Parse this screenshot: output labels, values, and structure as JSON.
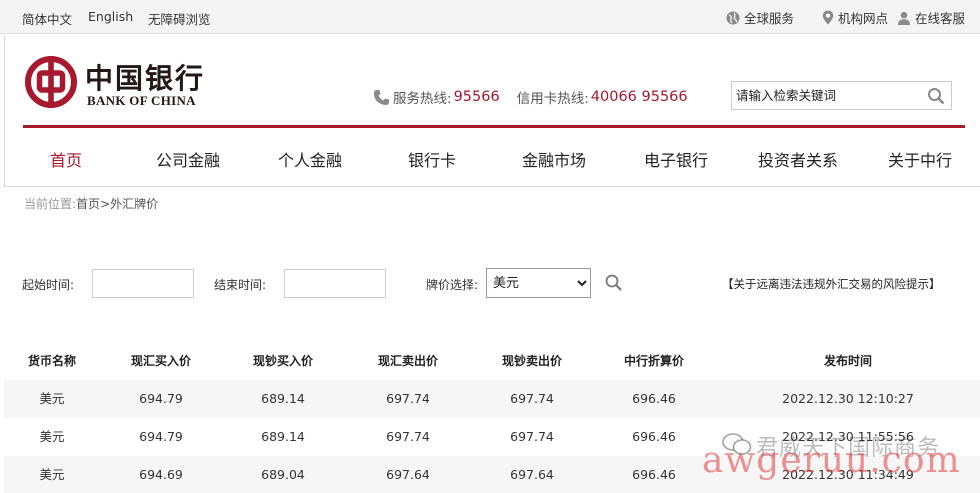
{
  "topbar": {
    "langs": [
      "简体中文",
      "English",
      "无障碍浏览"
    ],
    "right": [
      {
        "icon": "globe-icon",
        "label": "全球服务"
      },
      {
        "icon": "location-pin-icon",
        "label": "机构网点"
      },
      {
        "icon": "user-icon",
        "label": "在线客服"
      }
    ]
  },
  "header": {
    "logo_cn": "中国银行",
    "logo_en": "BANK OF CHINA",
    "service_label": "服务热线:",
    "service_number": "95566",
    "card_label": "信用卡热线:",
    "card_number": "40066 95566",
    "search_placeholder": "请输入检索关键词",
    "brand_color": "#a6192e"
  },
  "nav": [
    "首页",
    "公司金融",
    "个人金融",
    "银行卡",
    "金融市场",
    "电子银行",
    "投资者关系",
    "关于中行"
  ],
  "breadcrumb": {
    "prefix": "当前位置:",
    "home": "首页",
    "sep": ">",
    "current": "外汇牌价"
  },
  "filters": {
    "start_label": "起始时间:",
    "end_label": "结束时间:",
    "currency_label": "牌价选择:",
    "currency_selected": "美元",
    "risk_notice": "【关于远离违法违规外汇交易的风险提示】"
  },
  "table": {
    "headers": [
      "货币名称",
      "现汇买入价",
      "现钞买入价",
      "现汇卖出价",
      "现钞卖出价",
      "中行折算价",
      "发布时间"
    ],
    "rows": [
      [
        "美元",
        "694.79",
        "689.14",
        "697.74",
        "697.74",
        "696.46",
        "2022.12.30 12:10:27"
      ],
      [
        "美元",
        "694.79",
        "689.14",
        "697.74",
        "697.74",
        "696.46",
        "2022.12.30 11:55:56"
      ],
      [
        "美元",
        "694.69",
        "689.04",
        "697.64",
        "697.64",
        "696.46",
        "2022.12.30 11:34:49"
      ]
    ]
  },
  "watermark": {
    "line1": "君威天下国际商务",
    "line2": "awgeruu.com"
  }
}
